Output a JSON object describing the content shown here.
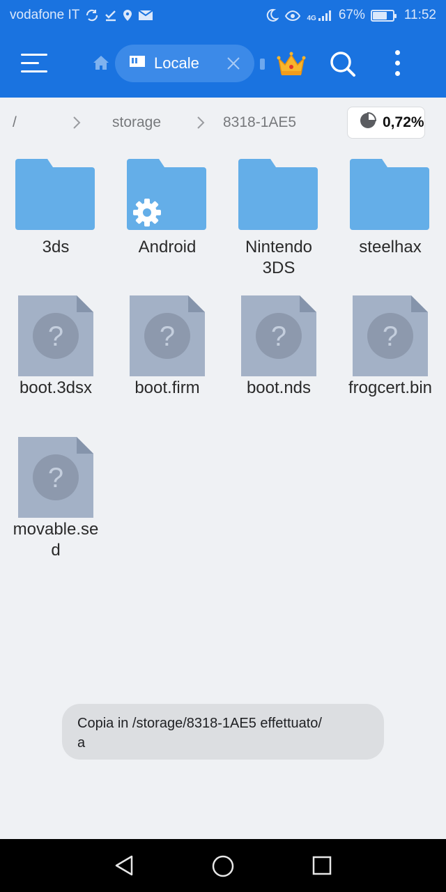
{
  "status_bar": {
    "carrier": "vodafone IT",
    "network": "4G",
    "battery": "67%",
    "battery_level": 0.67,
    "time": "11:52"
  },
  "toolbar": {
    "tab_label": "Locale"
  },
  "breadcrumb": {
    "root": "/",
    "items": [
      "storage",
      "8318-1AE5"
    ],
    "storage_usage": "0,72%"
  },
  "folders": [
    {
      "name_lines": [
        "3ds"
      ]
    },
    {
      "name_lines": [
        "Android"
      ]
    },
    {
      "name_lines": [
        "Nintendo",
        "3DS"
      ]
    },
    {
      "name_lines": [
        "steelhax"
      ]
    }
  ],
  "files": [
    {
      "name_lines": [
        "boot.3dsx"
      ]
    },
    {
      "name_lines": [
        "boot.firm"
      ]
    },
    {
      "name_lines": [
        "boot.nds"
      ]
    },
    {
      "name_lines": [
        "frogcert.bin"
      ]
    },
    {
      "name_lines": [
        "movable.se",
        "d"
      ]
    }
  ],
  "toast": {
    "line1": "Copia in /storage/8318-1AE5 effettuato/",
    "line2": "a"
  },
  "colors": {
    "primary": "#1a73e0",
    "folder": "#64aee8",
    "unknown_file": "#a3b1c6"
  }
}
